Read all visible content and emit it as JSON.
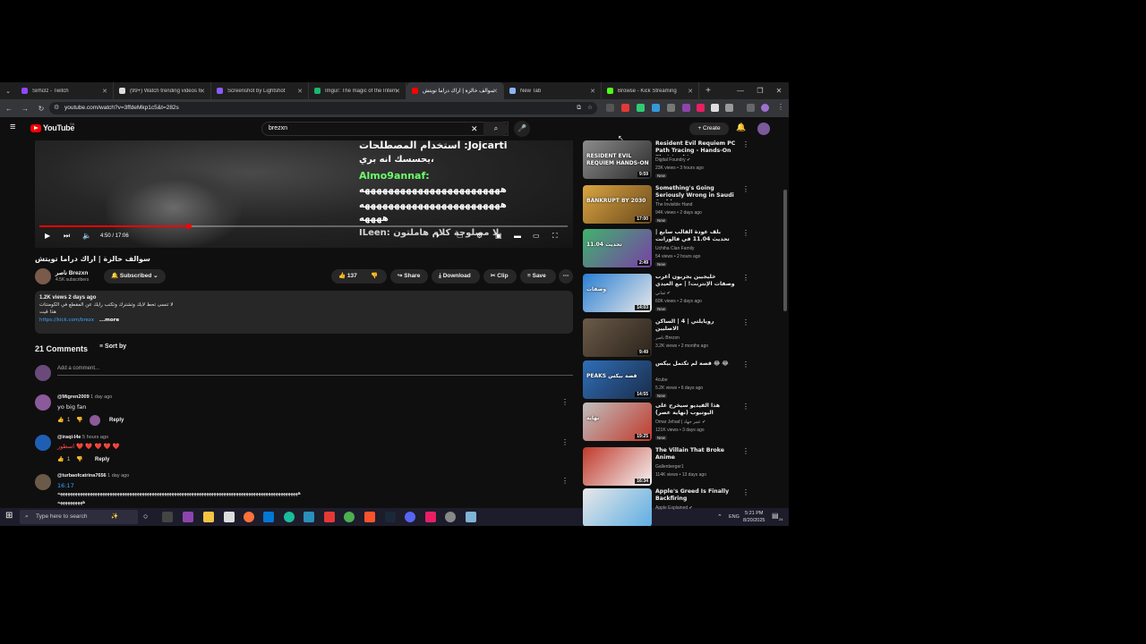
{
  "browser": {
    "tabs": [
      {
        "title": "Sirhi3z - Twitch",
        "color": "#9146ff"
      },
      {
        "title": "(99+) Watch trending videos fo",
        "color": "#dddddd"
      },
      {
        "title": "Screenshot by Lightshot",
        "color": "#8a5cf6"
      },
      {
        "title": "Imgur: The magic of the Intern",
        "color": "#1bb76e"
      },
      {
        "title": "سوالف خالزة | اراك دراما تويتش",
        "color": "#ff0000"
      },
      {
        "title": "New Tab",
        "color": "#8ab4f8"
      },
      {
        "title": "Browse - Kick Streaming",
        "color": "#53fc18"
      }
    ],
    "url": "youtube.com/watch?v=3ffdeMkp1c5&t=282s"
  },
  "youtube": {
    "logo": "YouTube",
    "country": "SA",
    "search_value": "brezxn",
    "create_label": "Create"
  },
  "player": {
    "overlay": {
      "l1": "استخدام المصطلحات :Jojcarti",
      "l2": "يحسسك انه بري،",
      "l3": "Almo9annaf:",
      "l4": "ههههههههههههههههههههههههه",
      "l5": "ههههههههههههههههههههههههه",
      "l6": "ههههه",
      "l7": "ILeen: لا مصلوحة كلام هاملتون"
    },
    "time": "4:50 / 17:06",
    "progress": 0.283
  },
  "video": {
    "title": "سوالف خالزة | اراك دراما تويتش",
    "channel": "Brezxn",
    "channel_tag": "ناصر",
    "subscribers": "4.5K subscribers",
    "subscribed_label": "Subscribed",
    "likes": "137",
    "share": "Share",
    "download": "Download",
    "clip": "Clip",
    "save": "Save",
    "views_date": "1.2K views  2 days ago",
    "desc1": "لا تنسى تحط لايك وتشترك وتكتب رايك عن المقطع في الكومنتات",
    "desc2": "هذا قيت",
    "desc_link": "https://kick.com/brezx",
    "desc_more": "...more"
  },
  "comments": {
    "count": "21 Comments",
    "sort": "Sort by",
    "add_placeholder": "Add a comment...",
    "items": [
      {
        "author": "@Migren2009",
        "time": "1 day ago",
        "text": "yo big fan",
        "likes": "1",
        "reply": "Reply"
      },
      {
        "author": "@iraqi-l4e",
        "time": "5 hours ago",
        "text": "اسطور ❤️ ❤️ ❤️ ❤️ ❤️",
        "likes": "1",
        "reply": "Reply"
      },
      {
        "author": "@turbaofcatrina7656",
        "time": "1 day ago",
        "link": "16:17",
        "text": "هههههههههههههههههههههههههههههههههههههههههههههههههههههههههههههههههههههههههههههههههههههههههههههههههه",
        "text2": "ههههههههههه"
      }
    ]
  },
  "recommendations": [
    {
      "title": "Resident Evil Requiem PC Path Tracing - Hands-On First Look!",
      "channel": "Digital Foundry ✔",
      "views": "23K views • 3 hours ago",
      "badge": "New",
      "duration": "9:59",
      "colors": [
        "#8c8c8c",
        "#2b2b2b"
      ],
      "thumb_text": "RESIDENT EVIL REQUIEM HANDS-ON"
    },
    {
      "title": "Something's Going Seriously Wrong in Saudi Arabia",
      "channel": "The Invisible Hand",
      "views": "94K views • 2 days ago",
      "badge": "New",
      "duration": "17:00",
      "colors": [
        "#d9a441",
        "#6b4a1c"
      ],
      "thumb_text": "BANKRUPT BY 2030"
    },
    {
      "title": "بلف عودة القالب سابع | تحديث 11.04 في فالورانت",
      "channel": "Uchiha Clan Family",
      "views": "54 views • 2 hours ago",
      "badge": "New",
      "duration": "2:49",
      "colors": [
        "#3fb36b",
        "#7a3fa8"
      ],
      "thumb_text": "تحديث 11.04"
    },
    {
      "title": "خليجيين يجربون أغرب وصفات الإنترنت! | مع العيدي",
      "channel": "ثماني ✔",
      "views": "60K views • 2 days ago",
      "badge": "New",
      "duration": "14:03",
      "colors": [
        "#2a7fd4",
        "#e8e8e8"
      ],
      "thumb_text": "وصفات"
    },
    {
      "title": "رويايلتي | 4 | الساكن الاصليين",
      "channel": "ناصر Brezxn",
      "views": "3.2K views • 2 months ago",
      "badge": "",
      "duration": "9:49",
      "colors": [
        "#6b5a48",
        "#2b231b"
      ],
      "thumb_text": ""
    },
    {
      "title": "قصة لم تكتمل بيكس 😂 😂",
      "channel": "4cube",
      "views": "5.2K views • 6 days ago",
      "badge": "New",
      "duration": "14:55",
      "colors": [
        "#2f6fb8",
        "#1a2c4a"
      ],
      "thumb_text": "PEAKS قصة بيكس"
    },
    {
      "title": "هذا الفيديو سيخرج على اليوتيوب (نهاية عصر)",
      "channel": "Omar Jehad | عمر جهاد ✔",
      "views": "121K views • 3 days ago",
      "badge": "New",
      "duration": "19:25",
      "colors": [
        "#bfbfbf",
        "#c0392b"
      ],
      "thumb_text": "نهاية"
    },
    {
      "title": "The Villain That Broke Anime",
      "channel": "Gallenberger1",
      "views": "114K views • 13 days ago",
      "badge": "",
      "duration": "16:34",
      "colors": [
        "#c0392b",
        "#f4f4f4"
      ],
      "thumb_text": ""
    },
    {
      "title": "Apple's Greed Is Finally Backfiring",
      "channel": "Apple Explained ✔",
      "views": "",
      "badge": "",
      "duration": "",
      "colors": [
        "#e8e8e8",
        "#5dade2"
      ],
      "thumb_text": ""
    }
  ],
  "taskbar": {
    "search_placeholder": "Type here to search",
    "lang": "ENG",
    "time": "5:21 PM",
    "date": "8/20/2025",
    "notif": "24"
  },
  "icons": {
    "brand_red": "#ff0000",
    "link_blue": "#3ea6ff"
  }
}
